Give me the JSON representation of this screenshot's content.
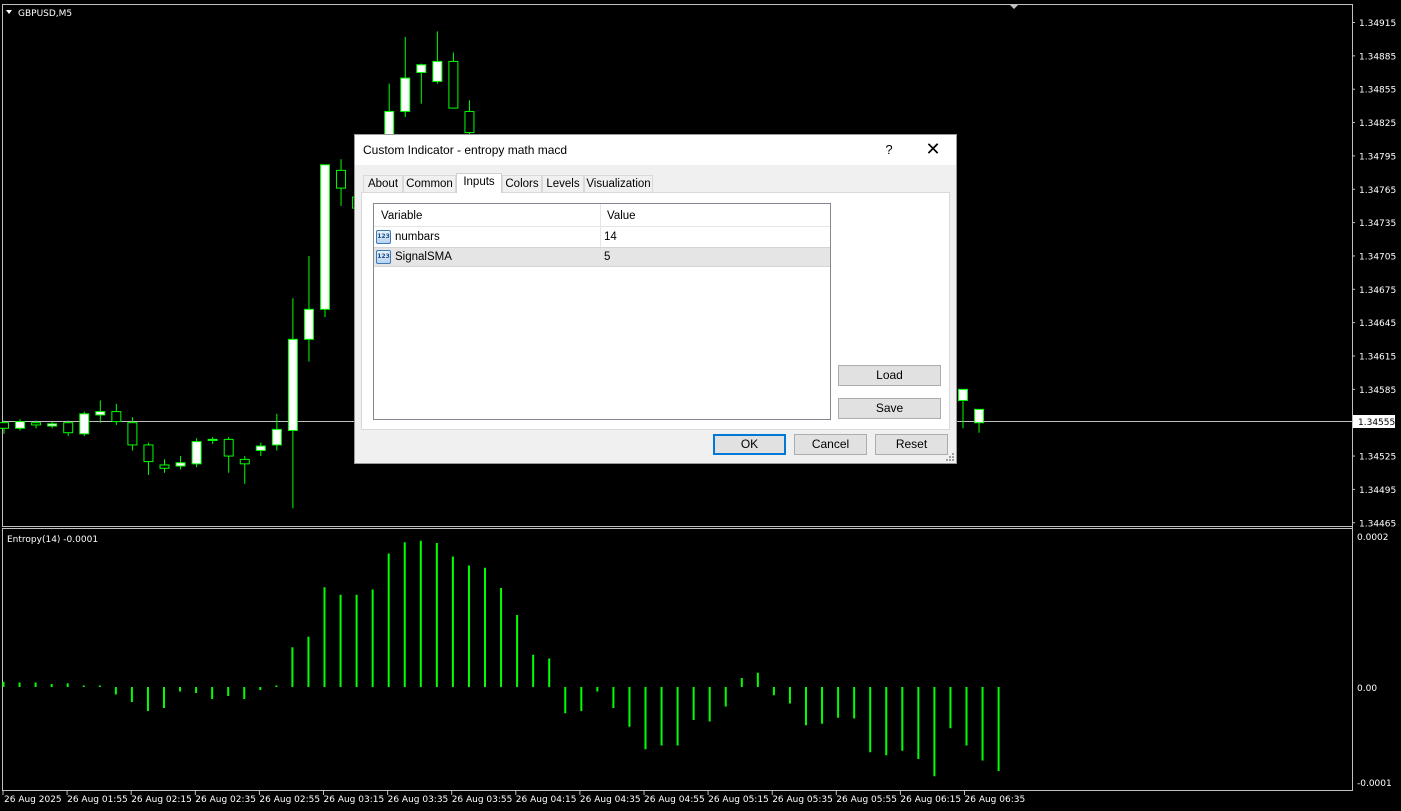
{
  "chart": {
    "symbol_label": "GBPUSD,M5",
    "price_axis_labels": [
      "1.34915",
      "1.34885",
      "1.34855",
      "1.34825",
      "1.34795",
      "1.34765",
      "1.34735",
      "1.34705",
      "1.34675",
      "1.34645",
      "1.34615",
      "1.34585",
      "1.34525",
      "1.34495",
      "1.34465"
    ],
    "current_price": "1.34555",
    "indicator_label": "Entropy(14) -0.0001",
    "indicator_axis_labels": [
      "0.0002",
      "0.00",
      "-0.0001"
    ],
    "time_axis_labels": [
      "26 Aug 2025",
      "26 Aug 01:55",
      "26 Aug 02:15",
      "26 Aug 02:35",
      "26 Aug 02:55",
      "26 Aug 03:15",
      "26 Aug 03:35",
      "26 Aug 03:55",
      "26 Aug 04:15",
      "26 Aug 04:35",
      "26 Aug 04:55",
      "26 Aug 05:15",
      "26 Aug 05:35",
      "26 Aug 05:55",
      "26 Aug 06:15",
      "26 Aug 06:35"
    ],
    "colors": {
      "background": "#000000",
      "bull_candle": "#ffffff",
      "candle_outline": "#00ff00",
      "histogram": "#00ff00",
      "text": "#ffffff",
      "grid_line": "#c0c0c0"
    }
  },
  "chart_data": [
    {
      "type": "candlestick",
      "title": "GBPUSD,M5",
      "ylim": [
        1.34455,
        1.34925
      ],
      "candles": [
        {
          "o": 1.34555,
          "h": 1.34557,
          "l": 1.34545,
          "c": 1.3455
        },
        {
          "o": 1.3455,
          "h": 1.34558,
          "l": 1.34548,
          "c": 1.34556
        },
        {
          "o": 1.34555,
          "h": 1.34557,
          "l": 1.3455,
          "c": 1.34553
        },
        {
          "o": 1.34552,
          "h": 1.34556,
          "l": 1.3455,
          "c": 1.34554
        },
        {
          "o": 1.34555,
          "h": 1.34557,
          "l": 1.34543,
          "c": 1.34546
        },
        {
          "o": 1.34545,
          "h": 1.34565,
          "l": 1.34543,
          "c": 1.34563
        },
        {
          "o": 1.34562,
          "h": 1.34575,
          "l": 1.34555,
          "c": 1.34565
        },
        {
          "o": 1.34565,
          "h": 1.34572,
          "l": 1.34553,
          "c": 1.34556
        },
        {
          "o": 1.34555,
          "h": 1.3456,
          "l": 1.3453,
          "c": 1.34535
        },
        {
          "o": 1.34535,
          "h": 1.34537,
          "l": 1.34508,
          "c": 1.3452
        },
        {
          "o": 1.34517,
          "h": 1.34522,
          "l": 1.3451,
          "c": 1.34514
        },
        {
          "o": 1.34516,
          "h": 1.34525,
          "l": 1.34513,
          "c": 1.34519
        },
        {
          "o": 1.34518,
          "h": 1.34541,
          "l": 1.34515,
          "c": 1.34538
        },
        {
          "o": 1.34539,
          "h": 1.34542,
          "l": 1.34536,
          "c": 1.3454
        },
        {
          "o": 1.3454,
          "h": 1.34542,
          "l": 1.3451,
          "c": 1.34525
        },
        {
          "o": 1.34522,
          "h": 1.34525,
          "l": 1.345,
          "c": 1.34518
        },
        {
          "o": 1.3453,
          "h": 1.34537,
          "l": 1.34525,
          "c": 1.34534
        },
        {
          "o": 1.34535,
          "h": 1.34563,
          "l": 1.3453,
          "c": 1.34549
        },
        {
          "o": 1.34548,
          "h": 1.34667,
          "l": 1.34478,
          "c": 1.3463
        },
        {
          "o": 1.3463,
          "h": 1.34705,
          "l": 1.3461,
          "c": 1.34657
        },
        {
          "o": 1.34657,
          "h": 1.34787,
          "l": 1.3465,
          "c": 1.34787
        },
        {
          "o": 1.34782,
          "h": 1.34792,
          "l": 1.3475,
          "c": 1.34766
        },
        {
          "o": 1.34758,
          "h": 1.3477,
          "l": 1.3474,
          "c": 1.34748
        },
        {
          "o": 1.34755,
          "h": 1.34762,
          "l": 1.3475,
          "c": 1.34762
        },
        {
          "o": 1.3476,
          "h": 1.3486,
          "l": 1.3474,
          "c": 1.34835
        },
        {
          "o": 1.34835,
          "h": 1.34902,
          "l": 1.3483,
          "c": 1.34865
        },
        {
          "o": 1.3487,
          "h": 1.34878,
          "l": 1.34842,
          "c": 1.34877
        },
        {
          "o": 1.34862,
          "h": 1.34907,
          "l": 1.3486,
          "c": 1.3488
        },
        {
          "o": 1.3488,
          "h": 1.34888,
          "l": 1.3484,
          "c": 1.34838
        },
        {
          "o": 1.34835,
          "h": 1.34845,
          "l": 1.3481,
          "c": 1.34816
        },
        {
          "o": 1.34575,
          "h": 1.34578,
          "l": 1.3455,
          "c": 1.34585
        },
        {
          "o": 1.34555,
          "h": 1.34566,
          "l": 1.34546,
          "c": 1.34567
        }
      ]
    },
    {
      "type": "bar",
      "title": "Entropy(14) -0.0001",
      "ylim": [
        -0.0001,
        0.0002
      ],
      "values": [
        3.5e-06,
        3e-06,
        3e-06,
        2e-06,
        2.5e-06,
        1e-06,
        1e-06,
        -5e-06,
        -1e-05,
        -1.6e-05,
        -1.4e-05,
        -3e-06,
        -4e-06,
        -8e-06,
        -6e-06,
        -8e-06,
        -2e-06,
        1e-06,
        2.65e-05,
        3.35e-05,
        6.65e-05,
        6.15e-05,
        6.15e-05,
        6.5e-05,
        8.9e-05,
        9.65e-05,
        9.75e-05,
        9.6e-05,
        8.7e-05,
        8.1e-05,
        7.95e-05,
        6.6e-05,
        4.8e-05,
        2.15e-05,
        1.9e-05,
        -1.75e-05,
        -1.6e-05,
        -3e-06,
        -1.4e-05,
        -2.65e-05,
        -4.15e-05,
        -3.9e-05,
        -3.9e-05,
        -2.2e-05,
        -2.3e-05,
        -1.3e-05,
        6e-06,
        9.5e-06,
        -5.5e-06,
        -1.1e-05,
        -2.55e-05,
        -2.45e-05,
        -2.05e-05,
        -2.1e-05,
        -4.35e-05,
        -4.55e-05,
        -4.25e-05,
        -4.8e-05,
        -5.95e-05,
        -2.75e-05,
        -3.9e-05,
        -4.9e-05,
        -5.6e-05
      ]
    }
  ],
  "dialog": {
    "title": "Custom Indicator - entropy math macd",
    "help_label": "?",
    "close_label": "✕",
    "tabs": [
      "About",
      "Common",
      "Inputs",
      "Colors",
      "Levels",
      "Visualization"
    ],
    "active_tab": "Inputs",
    "columns": [
      "Variable",
      "Value"
    ],
    "inputs": [
      {
        "icon": "int-icon",
        "icon_text": "123",
        "name": "numbars",
        "value": "14"
      },
      {
        "icon": "int-icon",
        "icon_text": "123",
        "name": "SignalSMA",
        "value": "5"
      }
    ],
    "selected_row": 1,
    "buttons": {
      "load": "Load",
      "save": "Save",
      "ok": "OK",
      "cancel": "Cancel",
      "reset": "Reset"
    }
  }
}
